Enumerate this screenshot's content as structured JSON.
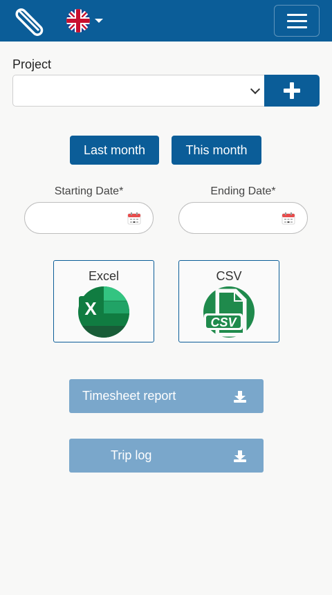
{
  "header": {
    "logo_icon": "logo-icon",
    "language_icon": "uk-flag-icon",
    "menu_icon": "hamburger-menu-icon"
  },
  "form": {
    "project_label": "Project",
    "project_value": "",
    "add_icon": "plus-icon",
    "last_month_label": "Last month",
    "this_month_label": "This month",
    "start_date_label": "Starting Date*",
    "start_date_value": "",
    "end_date_label": "Ending Date*",
    "end_date_value": ""
  },
  "exports": [
    {
      "label": "Excel",
      "icon": "excel-icon"
    },
    {
      "label": "CSV",
      "icon": "csv-file-icon"
    }
  ],
  "csv_icon_text": "CSV",
  "excel_icon_text": "X",
  "downloads": {
    "timesheet_label": "Timesheet report",
    "trip_log_label": "Trip log",
    "icon": "download-icon"
  },
  "colors": {
    "primary": "#0b5d98",
    "disabled_button": "#7aa7cb",
    "excel_green": "#107c41",
    "csv_green": "#1f8a4c"
  }
}
